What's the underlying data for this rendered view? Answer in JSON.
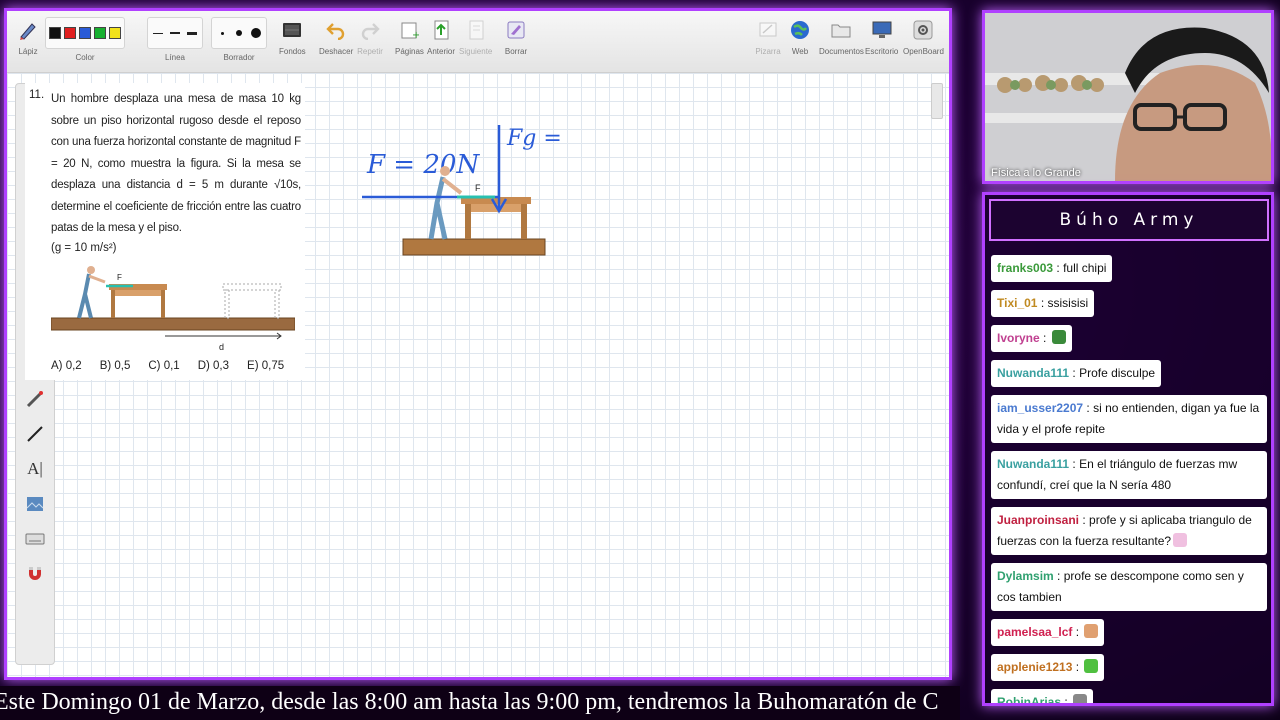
{
  "toolbar": {
    "groups": [
      {
        "name": "Lápiz",
        "icon": "pencil-icon"
      },
      {
        "name": "Color",
        "icon": "color-palette-icon"
      },
      {
        "name": "Línea",
        "icon": "line-style-icon"
      },
      {
        "name": "Borrador",
        "icon": "eraser-size-icon"
      },
      {
        "name": "Fondos",
        "icon": "background-icon"
      },
      {
        "name": "Deshacer",
        "icon": "undo-icon"
      },
      {
        "name": "Repetir",
        "icon": "redo-icon"
      },
      {
        "name": "Páginas",
        "icon": "pages-icon"
      },
      {
        "name": "Anterior",
        "icon": "previous-page-icon"
      },
      {
        "name": "Siguiente",
        "icon": "next-page-icon"
      },
      {
        "name": "Borrar",
        "icon": "clear-icon"
      },
      {
        "name": "Pizarra",
        "icon": "board-icon"
      },
      {
        "name": "Web",
        "icon": "globe-icon"
      },
      {
        "name": "Documentos",
        "icon": "folder-icon"
      },
      {
        "name": "Escritorio",
        "icon": "desktop-icon"
      },
      {
        "name": "OpenBoard",
        "icon": "settings-icon"
      }
    ],
    "colors": [
      "#111111",
      "#e02020",
      "#2a5bd7",
      "#18b030",
      "#f2e21a"
    ]
  },
  "left_tools": [
    "pen-icon",
    "marker-icon",
    "highlighter-icon",
    "selector-icon",
    "interact-icon",
    "hand-icon",
    "zoom-in-icon",
    "zoom-out-icon",
    "laser-pointer-icon",
    "line-tool-icon",
    "text-tool-icon",
    "capture-icon",
    "keyboard-icon",
    "magnet-icon"
  ],
  "problem": {
    "number": "11.",
    "text": "Un hombre desplaza una mesa de masa 10 kg sobre un piso horizontal rugoso desde el reposo con una fuerza horizontal constante de magnitud F = 20 N, como muestra la figura. Si la mesa se desplaza una distancia d = 5 m durante √10s, determine el coeficiente de fricción entre las cuatro patas de la mesa y el piso.",
    "gravity": "(g = 10 m/s²)",
    "figure_force_label": "F",
    "figure_distance_label": "d",
    "options": [
      "A) 0,2",
      "B) 0,5",
      "C) 0,1",
      "D) 0,3",
      "E) 0,75"
    ]
  },
  "sketch": {
    "force_text": "F = 20N",
    "weight_text": "Fg =",
    "force_label": "F"
  },
  "webcam": {
    "caption": "Física a lo Grande"
  },
  "chat": {
    "title": "Búho Army",
    "messages": [
      {
        "user": "franks003",
        "text": "full chipi",
        "color": "#3a9a3a"
      },
      {
        "user": "Tixi_01",
        "text": "ssisisisi",
        "color": "#c08a20"
      },
      {
        "user": "Ivoryne",
        "text": "",
        "color": "#c04090",
        "emote": "#3a8a3a"
      },
      {
        "user": "Nuwanda111",
        "text": "Profe disculpe",
        "color": "#3aa0a0"
      },
      {
        "user": "iam_usser2207",
        "text": "si no entienden, digan ya fue la vida y el profe repite",
        "color": "#4a7ad0"
      },
      {
        "user": "Nuwanda111",
        "text": "En el triángulo de fuerzas mw confundí, creí que la N sería 480",
        "color": "#3aa0a0"
      },
      {
        "user": "Juanproinsani",
        "text": "profe y si aplicaba triangulo de fuerzas con la fuerza resultante?",
        "color": "#c02040",
        "emote": "#f0c0e0"
      },
      {
        "user": "Dylamsim",
        "text": "profe se descompone como sen y cos tambien",
        "color": "#30a070"
      },
      {
        "user": "pamelsaa_lcf",
        "text": "",
        "color": "#d02050",
        "emote": "#e0a070"
      },
      {
        "user": "applenie1213",
        "text": "",
        "color": "#c07020",
        "emote": "#50c040"
      },
      {
        "user": "RobinArias",
        "text": "",
        "color": "#30a070",
        "emote": "#888888"
      },
      {
        "user": "RobinArias",
        "text": "",
        "color": "#30a070",
        "emote": "#888888"
      }
    ]
  },
  "ticker": {
    "text": "Este Domingo 01 de Marzo, desde las 8:00 am hasta las 9:00 pm, tendremos la Buhomaratón de C"
  }
}
